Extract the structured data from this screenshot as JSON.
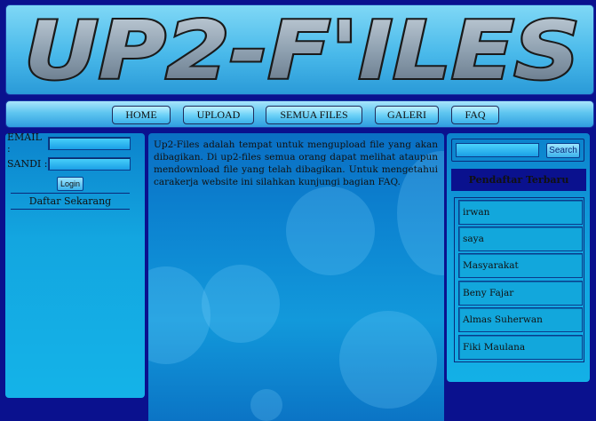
{
  "header": {
    "logo_text": "UP2-F'ILES"
  },
  "nav": [
    {
      "label": "HOME"
    },
    {
      "label": "UPLOAD"
    },
    {
      "label": "SEMUA FILES"
    },
    {
      "label": "GALERI"
    },
    {
      "label": "FAQ"
    }
  ],
  "login": {
    "email_label": "EMAIL :",
    "password_label": "SANDI :",
    "login_button": "Login",
    "register_link": "Daftar Sekarang"
  },
  "main": {
    "intro": "Up2-Files adalah tempat untuk mengupload file yang akan dibagikan. Di up2-files semua orang dapat melihat ataupun mendownload file yang telah dibagikan. Untuk mengetahui carakerja website ini silahkan kunjungi bagian FAQ."
  },
  "sidebar": {
    "search_button": "Search",
    "recent_title": "Pendaftar Terbaru",
    "users": [
      {
        "name": "irwan"
      },
      {
        "name": "saya"
      },
      {
        "name": "Masyarakat"
      },
      {
        "name": "Beny Fajar"
      },
      {
        "name": "Almas Suherwan"
      },
      {
        "name": "Fiki Maulana"
      }
    ]
  },
  "colors": {
    "page_bg": "#0a118e",
    "panel_blue": "#13a6e0",
    "nav_bg": "#5ec5f0"
  }
}
